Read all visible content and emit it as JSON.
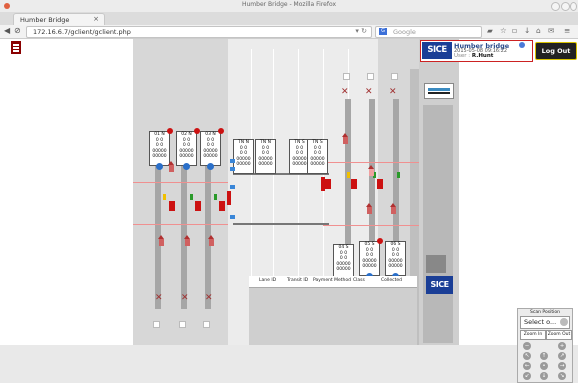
{
  "browser": {
    "window_title": "Humber Bridge - Mozilla Firefox",
    "tab_label": "Humber Bridge",
    "new_tab_icon": "plus-icon",
    "url": "172.16.6.7/gclient/gclient.php",
    "search_placeholder": "Google",
    "search_engine_letter": "G"
  },
  "header": {
    "logo_text": "SICE",
    "site_name": "Humber bridge",
    "date": "2015-05-08 09:16:22",
    "user_label": "User :",
    "user_name": "R.Hunt",
    "logout_label": "Log Out"
  },
  "booths_top": [
    {
      "id": "01 N",
      "l2": "0  0",
      "l3": "0  0",
      "l4": "00000",
      "l5": "00000"
    },
    {
      "id": "02 N",
      "l2": "0  0",
      "l3": "0  0",
      "l4": "00000",
      "l5": "00000"
    },
    {
      "id": "03 N",
      "l2": "0  0",
      "l3": "0  0",
      "l4": "00000",
      "l5": "00000"
    }
  ],
  "booths_mid": [
    {
      "id": "TN N",
      "l2": "0  0",
      "l3": "0  0",
      "l4": "00000",
      "l5": "00000"
    },
    {
      "id": "TN N",
      "l2": "0  0",
      "l3": "0  0",
      "l4": "00000",
      "l5": "00000"
    },
    {
      "id": "TN S",
      "l2": "0  0",
      "l3": "0  0",
      "l4": "00000",
      "l5": "00000"
    },
    {
      "id": "TN S",
      "l2": "0  0",
      "l3": "0  0",
      "l4": "00000",
      "l5": "00000"
    }
  ],
  "booths_bottom": [
    {
      "id": "04 S",
      "l2": "0  0",
      "l3": "0  0",
      "l4": "00000",
      "l5": "00000"
    },
    {
      "id": "05 S",
      "l2": "0  0",
      "l3": "0  0",
      "l4": "00000",
      "l5": "00000"
    },
    {
      "id": "06 S",
      "l2": "0  0",
      "l3": "0  0",
      "l4": "00000",
      "l5": "00000"
    }
  ],
  "table": {
    "columns": [
      "Lane ID",
      "Transit ID",
      "Payment Method",
      "Class",
      "Collected"
    ]
  },
  "zoom_panel": {
    "title": "Scan Position",
    "select_value": "Select o...",
    "zoom_in": "Zoom In",
    "zoom_out": "Zoom Out"
  },
  "colors": {
    "brand": "#1a3e96",
    "alert_red": "#cc1111",
    "logout_border": "#d9c200"
  }
}
